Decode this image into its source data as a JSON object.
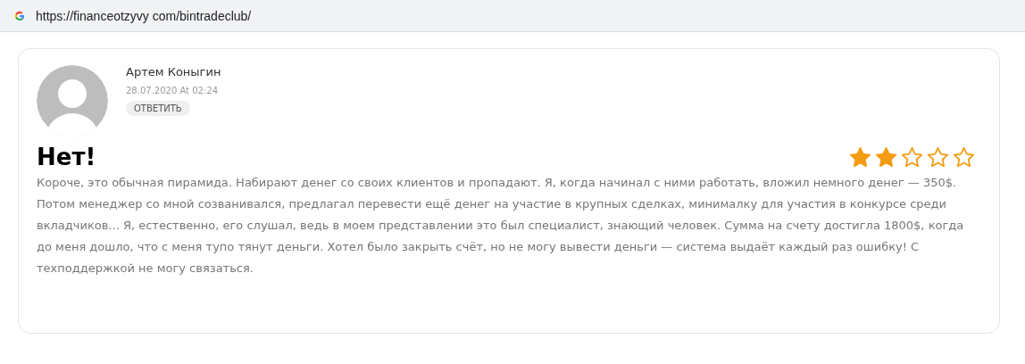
{
  "address_bar": {
    "url": "https://financeotzyvy com/bintradeclub/"
  },
  "review": {
    "author": "Артем Коныгин",
    "date": "28.07.2020 At 02:24",
    "reply_button": "ОТВЕТИТЬ",
    "title": "Нет!",
    "stars": 2,
    "text": "Короче, это обычная пирамида. Набирают денег со своих клиентов и пропадают. Я, когда начинал с ними работать, вложил немного денег — 350$. Потом менеджер со мной созванивался, предлагал перевести ещё денег на участие в крупных сделках, минималку для участия в конкурсе среди вкладчиков... Я, естественно, его слушал, ведь в моем представлении это был специалист, знающий человек. Сумма на счету достигла 1800$, когда до меня дошло, что с меня тупо тянут деньги. Хотел было закрыть счёт, но не могу вывести деньги — система выдаёт каждый раз ошибку! С техподдержкой не могу связаться."
  }
}
